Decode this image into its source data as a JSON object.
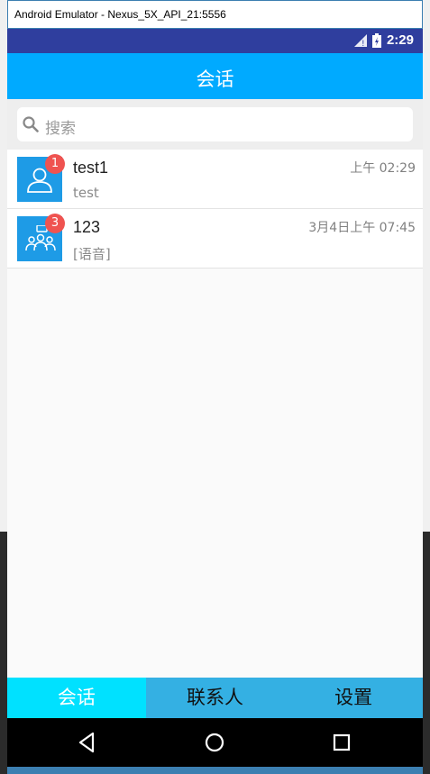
{
  "window": {
    "title": "Android Emulator - Nexus_5X_API_21:5556"
  },
  "status_bar": {
    "time": "2:29"
  },
  "app_bar": {
    "title": "会话"
  },
  "search": {
    "placeholder": "搜索"
  },
  "conversations": [
    {
      "name": "test1",
      "message": "test",
      "time": "上午 02:29",
      "unread": "1",
      "avatar_icon": "person-icon"
    },
    {
      "name": "123",
      "message": "[语音]",
      "time": "3月4日上午 07:45",
      "unread": "3",
      "avatar_icon": "group-icon"
    }
  ],
  "tabs": [
    {
      "label": "会话",
      "active": true
    },
    {
      "label": "联系人",
      "active": false
    },
    {
      "label": "设置",
      "active": false
    }
  ],
  "colors": {
    "status_bar": "#2f3e9e",
    "app_bar": "#00aaff",
    "tab_bar": "#34b0e3",
    "tab_active": "#00e1ff",
    "avatar": "#1e9be6",
    "badge": "#ef5350"
  }
}
